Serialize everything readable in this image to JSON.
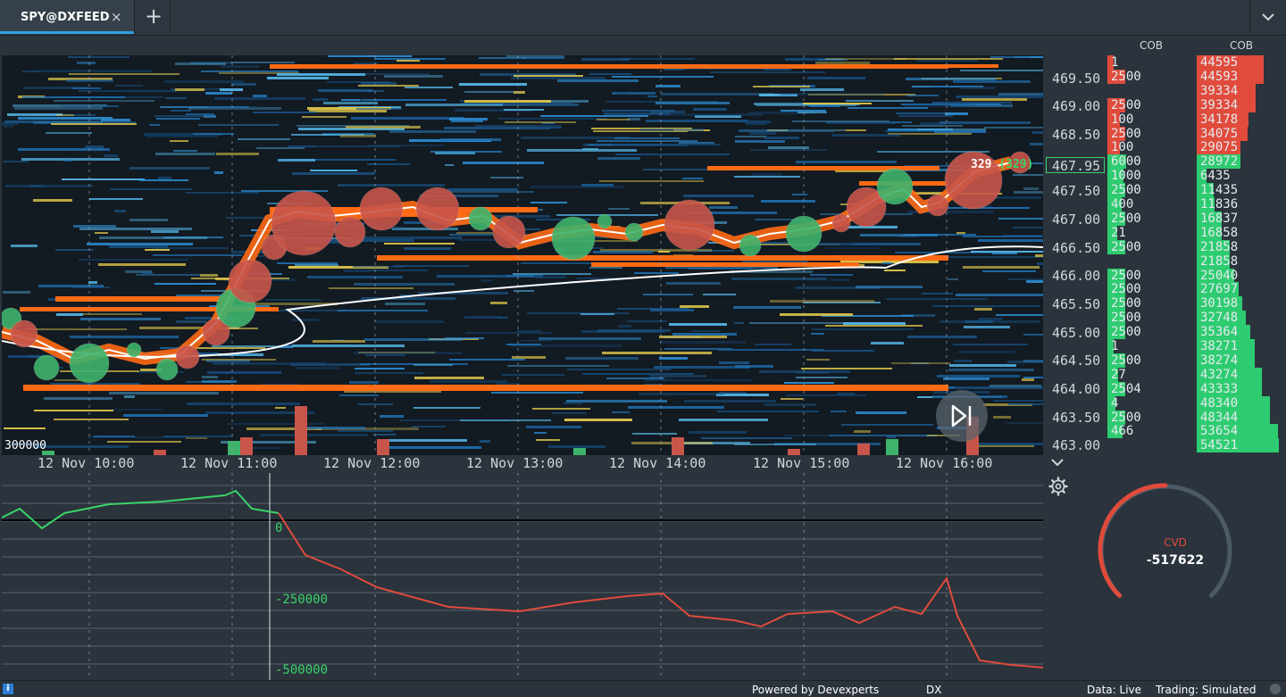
{
  "tab": {
    "label": "SPY@DXFEED",
    "close": "×",
    "add": "+"
  },
  "cob_headers": [
    "COB",
    "COB"
  ],
  "price_axis": [
    "469.50",
    "469.00",
    "468.50",
    "467.95",
    "467.50",
    "467.00",
    "466.50",
    "466.00",
    "465.50",
    "465.00",
    "464.50",
    "464.00",
    "463.50",
    "463.00"
  ],
  "current_price": "467.95",
  "current_label": {
    "trades": "329",
    "paren": "(329)"
  },
  "big_volume_label": "300000",
  "time_axis": [
    "12 Nov 10:00",
    "12 Nov 11:00",
    "12 Nov 12:00",
    "12 Nov 13:00",
    "12 Nov 14:00",
    "12 Nov 15:00",
    "12 Nov 16:00"
  ],
  "cob_left": [
    "1",
    "2500",
    "",
    "2500",
    "100",
    "2500",
    "100",
    "6000",
    "1000",
    "2500",
    "400",
    "2500",
    "21",
    "2500",
    "",
    "2500",
    "2500",
    "2500",
    "2500",
    "2500",
    "1",
    "2500",
    "27",
    "2504",
    "4",
    "2500",
    "466"
  ],
  "cob_right": [
    "44595",
    "44593",
    "39334",
    "39334",
    "34178",
    "34075",
    "29075",
    "28972",
    "6435",
    "11435",
    "11836",
    "16837",
    "16858",
    "21858",
    "21858",
    "25040",
    "27697",
    "30198",
    "32748",
    "35364",
    "38271",
    "38274",
    "43274",
    "43333",
    "48340",
    "48344",
    "53654",
    "54521"
  ],
  "cvd_ticks": [
    "0",
    "-250000",
    "-500000"
  ],
  "gauge": {
    "label": "CVD",
    "value": "-517622"
  },
  "status": {
    "powered": "Powered by Devexperts",
    "dx": "DX",
    "data": "Data: Live",
    "trading": "Trading: Simulated"
  },
  "colors": {
    "ask": "#e04b3c",
    "bid": "#2ecc71",
    "accent": "#2f9fe3",
    "bubble_red": "#c8554a",
    "bubble_green": "#3fb36c"
  }
}
